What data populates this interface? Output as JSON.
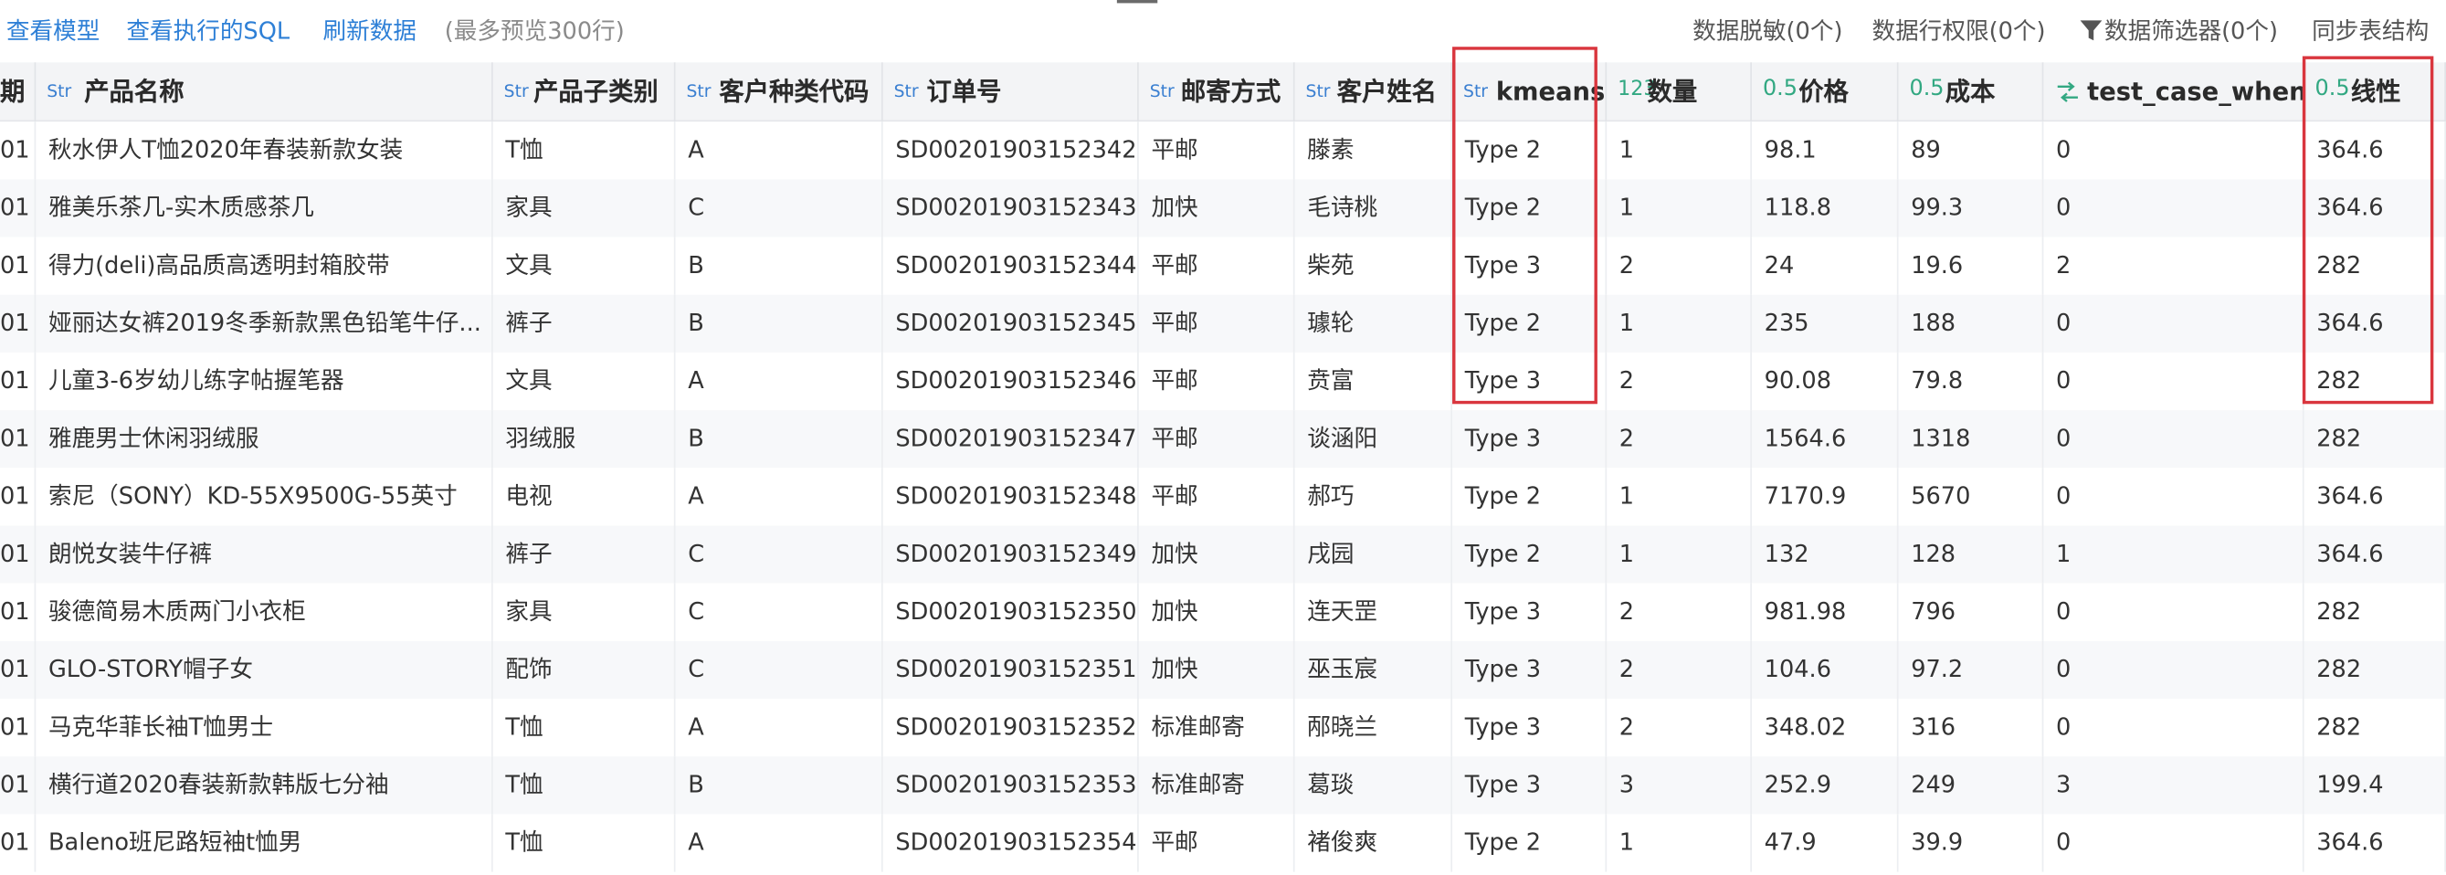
{
  "toolbar": {
    "view_model": "查看模型",
    "view_sql": "查看执行的SQL",
    "refresh": "刷新数据",
    "hint": "(最多预览300行)",
    "desensitize": "数据脱敏(0个)",
    "row_permission": "数据行权限(0个)",
    "filter": "数据筛选器(0个)",
    "sync": "同步表结构"
  },
  "columns": [
    {
      "type": "",
      "name": "期"
    },
    {
      "type": "Str",
      "name": "产品名称"
    },
    {
      "type": "Str",
      "name": "产品子类别"
    },
    {
      "type": "Str",
      "name": "客户种类代码"
    },
    {
      "type": "Str",
      "name": "订单号"
    },
    {
      "type": "Str",
      "name": "邮寄方式"
    },
    {
      "type": "Str",
      "name": "客户姓名"
    },
    {
      "type": "Str",
      "name": "kmeans"
    },
    {
      "type": "123",
      "name": "数量"
    },
    {
      "type": "0.5",
      "name": "价格"
    },
    {
      "type": "0.5",
      "name": "成本"
    },
    {
      "type": "swap",
      "name": "test_case_when"
    },
    {
      "type": "0.5",
      "name": "线性"
    }
  ],
  "rows": [
    [
      "01",
      "秋水伊人T恤2020年春装新款女装",
      "T恤",
      "A",
      "SD00201903152342",
      "平邮",
      "滕素",
      "Type 2",
      "1",
      "98.1",
      "89",
      "0",
      "364.6"
    ],
    [
      "01",
      "雅美乐茶几-实木质感茶几",
      "家具",
      "C",
      "SD00201903152343",
      "加快",
      "毛诗桃",
      "Type 2",
      "1",
      "118.8",
      "99.3",
      "0",
      "364.6"
    ],
    [
      "01",
      "得力(deli)高品质高透明封箱胶带",
      "文具",
      "B",
      "SD00201903152344",
      "平邮",
      "柴苑",
      "Type 3",
      "2",
      "24",
      "19.6",
      "2",
      "282"
    ],
    [
      "01",
      "娅丽达女裤2019冬季新款黑色铅笔牛仔...",
      "裤子",
      "B",
      "SD00201903152345",
      "平邮",
      "璩轮",
      "Type 2",
      "1",
      "235",
      "188",
      "0",
      "364.6"
    ],
    [
      "01",
      "儿童3-6岁幼儿练字帖握笔器",
      "文具",
      "A",
      "SD00201903152346",
      "平邮",
      "贲富",
      "Type 3",
      "2",
      "90.08",
      "79.8",
      "0",
      "282"
    ],
    [
      "01",
      "雅鹿男士休闲羽绒服",
      "羽绒服",
      "B",
      "SD00201903152347",
      "平邮",
      "谈涵阳",
      "Type 3",
      "2",
      "1564.6",
      "1318",
      "0",
      "282"
    ],
    [
      "01",
      "索尼（SONY）KD-55X9500G-55英寸",
      "电视",
      "A",
      "SD00201903152348",
      "平邮",
      "郝巧",
      "Type 2",
      "1",
      "7170.9",
      "5670",
      "0",
      "364.6"
    ],
    [
      "01",
      "朗悦女装牛仔裤",
      "裤子",
      "C",
      "SD00201903152349",
      "加快",
      "戌园",
      "Type 2",
      "1",
      "132",
      "128",
      "1",
      "364.6"
    ],
    [
      "01",
      "骏德简易木质两门小衣柜",
      "家具",
      "C",
      "SD00201903152350",
      "加快",
      "连天罡",
      "Type 3",
      "2",
      "981.98",
      "796",
      "0",
      "282"
    ],
    [
      "01",
      "GLO-STORY帽子女",
      "配饰",
      "C",
      "SD00201903152351",
      "加快",
      "巫玉宸",
      "Type 3",
      "2",
      "104.6",
      "97.2",
      "0",
      "282"
    ],
    [
      "01",
      "马克华菲长袖T恤男士",
      "T恤",
      "A",
      "SD00201903152352",
      "标准邮寄",
      "邴晓兰",
      "Type 3",
      "2",
      "348.02",
      "316",
      "0",
      "282"
    ],
    [
      "01",
      "横行道2020春装新款韩版七分袖",
      "T恤",
      "B",
      "SD00201903152353",
      "标准邮寄",
      "葛琰",
      "Type 3",
      "3",
      "252.9",
      "249",
      "3",
      "199.4"
    ],
    [
      "01",
      "Baleno班尼路短袖t恤男",
      "T恤",
      "A",
      "SD00201903152354",
      "平邮",
      "褚俊爽",
      "Type 2",
      "1",
      "47.9",
      "39.9",
      "0",
      "364.6"
    ]
  ],
  "colors": {
    "link": "#2d7fd6",
    "highlight": "#d9363e",
    "type_str": "#3a7fd1",
    "type_num": "#32a882"
  },
  "icons": {
    "filter": "filter-icon",
    "computed_column": "swap-arrows-icon"
  }
}
